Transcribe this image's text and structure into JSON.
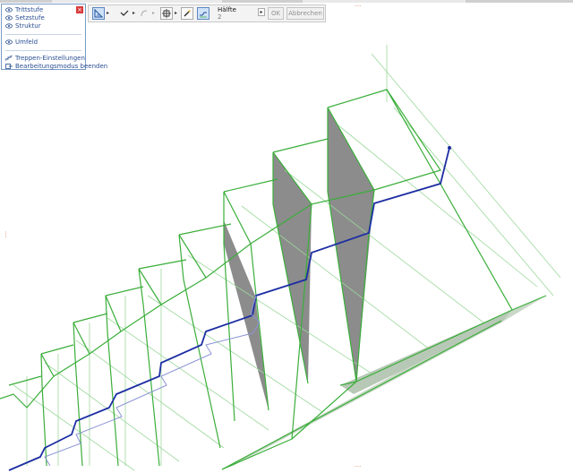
{
  "panel": {
    "items": [
      {
        "label": "Trittstufe",
        "icon": "eye-icon"
      },
      {
        "label": "Setzstufe",
        "icon": "eye-icon"
      },
      {
        "label": "Struktur",
        "icon": "eye-icon"
      },
      {
        "label": "Umfeld",
        "icon": "eye-icon"
      },
      {
        "label": "Treppen-Einstellungen",
        "icon": "stair-settings-icon"
      },
      {
        "label": "Bearbeitungsmodus beenden",
        "icon": "exit-edit-mode-icon"
      }
    ],
    "close_glyph": "×"
  },
  "toolbar": {
    "select_label": "Hälfte",
    "select_value": "2",
    "ok_label": "OK",
    "cancel_label": "Abbrechen"
  },
  "colors": {
    "edge": "#3aae3a",
    "edge_faint": "#9cd89c",
    "walkline": "#1d2ea3",
    "walkline_faint": "#8b94d6",
    "riser_shadow": "#8c8c8c",
    "panel_border": "#7a9cc6"
  }
}
